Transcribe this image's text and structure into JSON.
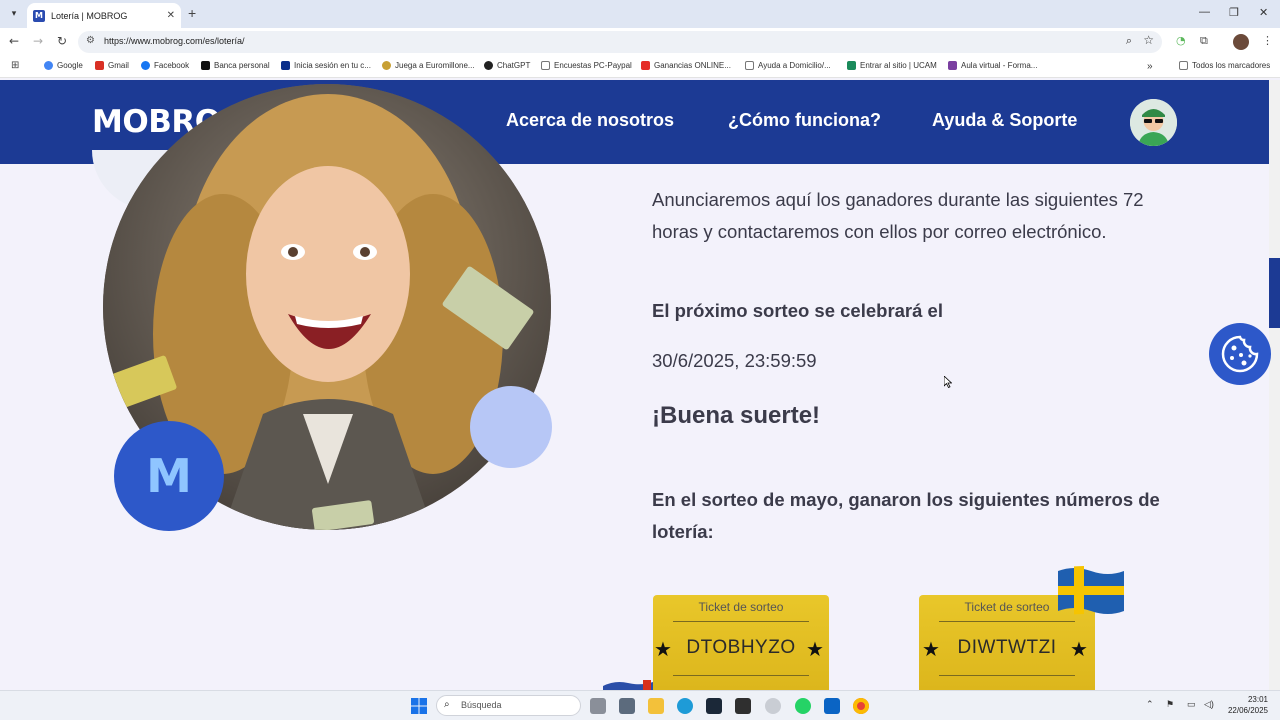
{
  "browser": {
    "tab_title": "Lotería | MOBROG",
    "url": "https://www.mobrog.com/es/lotería/",
    "bookmarks": [
      {
        "label": "Google",
        "color": "#4285f4"
      },
      {
        "label": "Gmail",
        "color": "#d93025"
      },
      {
        "label": "Facebook",
        "color": "#1877f2"
      },
      {
        "label": "Banca personal",
        "color": "#111111"
      },
      {
        "label": "Inicia sesión en tu c...",
        "color": "#0a2e8a"
      },
      {
        "label": "Juega a Euromillone...",
        "color": "#c8a034"
      },
      {
        "label": "ChatGPT",
        "color": "#222222"
      },
      {
        "label": "Encuestas PC-Paypal",
        "color": "#777777"
      },
      {
        "label": "Ganancias ONLINE...",
        "color": "#e52d27"
      },
      {
        "label": "Ayuda a Domicilio/...",
        "color": "#777777"
      },
      {
        "label": "Entrar al sitio | UCAM",
        "color": "#1a8a5a"
      },
      {
        "label": "Aula virtual - Forma...",
        "color": "#7a3fa0"
      }
    ],
    "all_bookmarks": "Todos los marcadores",
    "more_bookmarks": "»"
  },
  "header": {
    "logo": "MOBROG",
    "nav": [
      "Acerca de nosotros",
      "¿Cómo funciona?",
      "Ayuda & Soporte"
    ]
  },
  "content": {
    "intro": "Anunciaremos aquí los ganadores durante las siguientes 72 horas y contactaremos con ellos por correo electrónico.",
    "next_draw_title": "El próximo sorteo se celebrará el",
    "next_draw_date": "30/6/2025, 23:59:59",
    "good_luck": "¡Buena suerte!",
    "may_winners_title": "En el sorteo de mayo, ganaron los siguientes números de lotería:",
    "badge_letter": "M",
    "tickets": [
      {
        "label": "Ticket de sorteo",
        "code": "DTOBHYZO"
      },
      {
        "label": "Ticket de sorteo",
        "code": "DIWTWTZI"
      }
    ]
  },
  "taskbar": {
    "search_placeholder": "Búsqueda",
    "time": "23:01",
    "date": "22/06/2025"
  },
  "colors": {
    "header_bg": "#1c3a94",
    "accent_blue": "#2d58c9",
    "ticket_gold": "#e2bf22",
    "logo_check": "#f2c200"
  }
}
